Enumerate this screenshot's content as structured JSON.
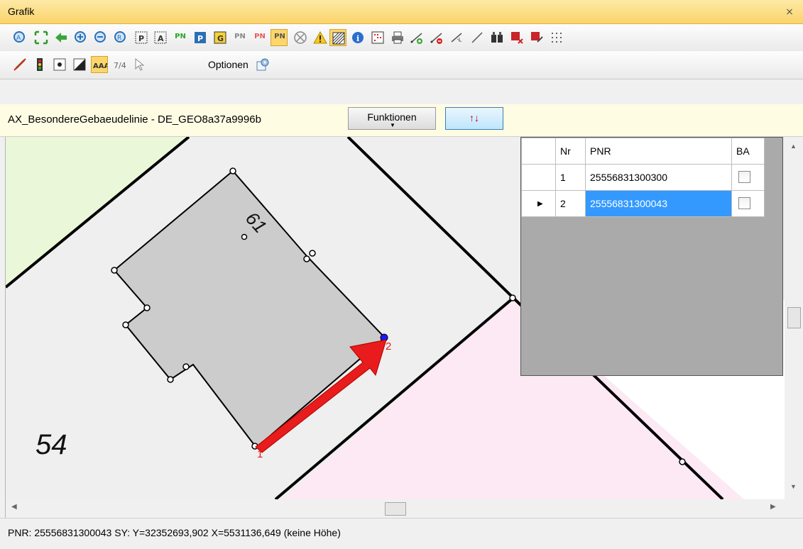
{
  "window": {
    "title": "Grafik"
  },
  "toolbar": {
    "options_label": "Optionen",
    "pn_label": "PN",
    "p_label": "P",
    "g_label": "G",
    "a_label": "A"
  },
  "object_bar": {
    "title": "AX_BesondereGebaeudelinie - DE_GEO8a37a9996b",
    "functions_label": "Funktionen",
    "swap_label": "↑↓"
  },
  "map": {
    "parcel_labels": {
      "left": "54",
      "house": "61"
    },
    "point_labels": {
      "p1": "1",
      "p2": "2"
    },
    "colors": {
      "building": "#cccccc",
      "parcel_gray": "#efefef",
      "parcel_green": "#eaf7d9",
      "parcel_pink": "#fde9f3",
      "arrow": "#e81c1c",
      "selected_point": "#1a1aff"
    }
  },
  "grid": {
    "columns": [
      "Nr",
      "PNR",
      "BA"
    ],
    "rows": [
      {
        "nr": "1",
        "pnr": "25556831300300",
        "ba": false
      },
      {
        "nr": "2",
        "pnr": "25556831300043",
        "ba": false
      }
    ]
  },
  "status": {
    "text": "PNR: 25556831300043 SY:  Y=32352693,902 X=5531136,649 (keine Höhe)"
  }
}
